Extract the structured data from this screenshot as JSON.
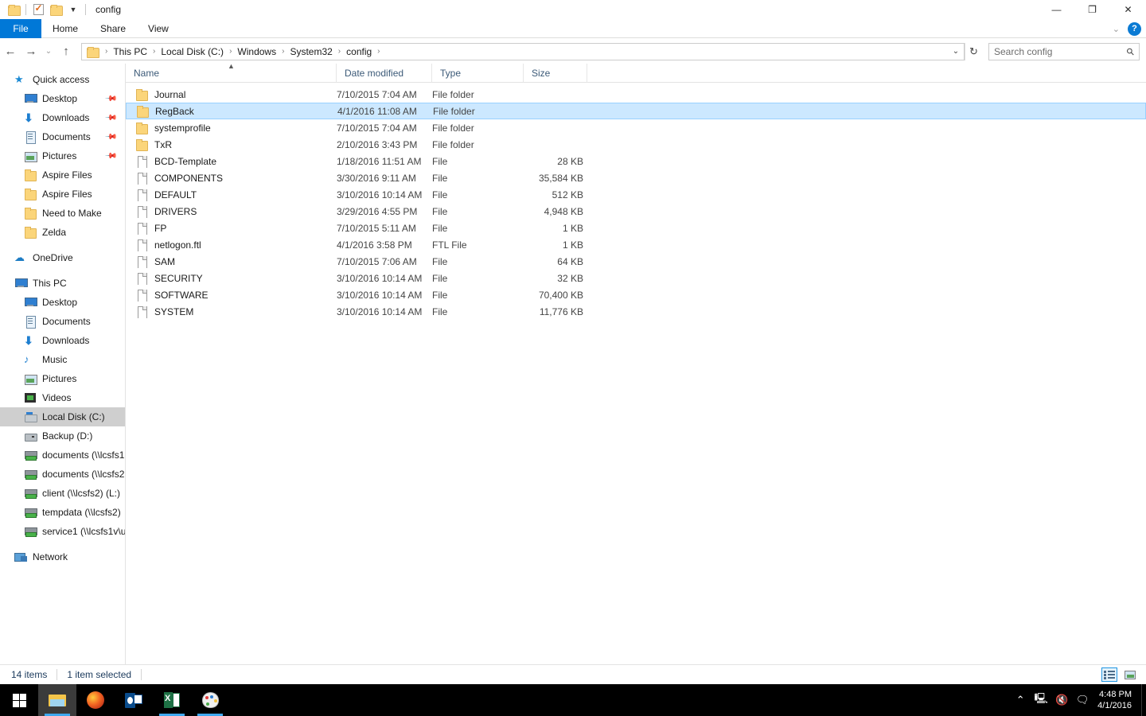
{
  "window": {
    "title": "config",
    "quick_access_toolbar": [
      {
        "name": "folder-icon",
        "label": "Folder"
      },
      {
        "name": "properties-icon",
        "label": "Properties"
      },
      {
        "name": "new-folder-icon",
        "label": "New folder"
      },
      {
        "name": "customize-chevron-icon",
        "label": "▾"
      }
    ],
    "controls": {
      "minimize": "—",
      "restore": "❐",
      "close": "✕"
    }
  },
  "ribbon": {
    "tabs": [
      {
        "label": "File",
        "active": true
      },
      {
        "label": "Home",
        "active": false
      },
      {
        "label": "Share",
        "active": false
      },
      {
        "label": "View",
        "active": false
      }
    ],
    "expand_chevron": "⌄",
    "help_label": "?"
  },
  "addressbar": {
    "back": "←",
    "forward": "→",
    "recent": "⌄",
    "up": "↑",
    "breadcrumbs": [
      "This PC",
      "Local Disk (C:)",
      "Windows",
      "System32",
      "config"
    ],
    "separator": "›",
    "dropdown": "⌄",
    "refresh": "↻"
  },
  "search": {
    "placeholder": "Search config",
    "icon": "search-icon"
  },
  "sidebar": {
    "groups": [
      {
        "name": "Quick access",
        "icon": "star-icon",
        "items": [
          {
            "label": "Desktop",
            "icon": "monitor-icon",
            "pinned": true
          },
          {
            "label": "Downloads",
            "icon": "download-arrow-icon",
            "pinned": true
          },
          {
            "label": "Documents",
            "icon": "document-icon",
            "pinned": true
          },
          {
            "label": "Pictures",
            "icon": "picture-icon",
            "pinned": true
          },
          {
            "label": "Aspire Files",
            "icon": "folder-icon",
            "pinned": false
          },
          {
            "label": "Aspire Files",
            "icon": "folder-icon",
            "pinned": false
          },
          {
            "label": "Need to Make",
            "icon": "folder-icon",
            "pinned": false
          },
          {
            "label": "Zelda",
            "icon": "folder-icon",
            "pinned": false
          }
        ]
      },
      {
        "name": "OneDrive",
        "icon": "cloud-icon",
        "items": []
      },
      {
        "name": "This PC",
        "icon": "computer-icon",
        "items": [
          {
            "label": "Desktop",
            "icon": "monitor-icon",
            "selected": false
          },
          {
            "label": "Documents",
            "icon": "document-icon",
            "selected": false
          },
          {
            "label": "Downloads",
            "icon": "download-arrow-icon",
            "selected": false
          },
          {
            "label": "Music",
            "icon": "music-note-icon",
            "selected": false
          },
          {
            "label": "Pictures",
            "icon": "picture-icon",
            "selected": false
          },
          {
            "label": "Videos",
            "icon": "video-icon",
            "selected": false
          },
          {
            "label": "Local Disk (C:)",
            "icon": "hard-disk-icon",
            "selected": true
          },
          {
            "label": "Backup (D:)",
            "icon": "disk-drive-icon",
            "selected": false
          },
          {
            "label": "documents (\\\\lcsfs1",
            "icon": "network-drive-icon",
            "selected": false
          },
          {
            "label": "documents (\\\\lcsfs2",
            "icon": "network-drive-icon",
            "selected": false
          },
          {
            "label": "client (\\\\lcsfs2) (L:)",
            "icon": "network-drive-icon",
            "selected": false
          },
          {
            "label": "tempdata (\\\\lcsfs2)",
            "icon": "network-drive-icon",
            "selected": false
          },
          {
            "label": "service1 (\\\\lcsfs1v\\u",
            "icon": "network-drive-icon",
            "selected": false
          }
        ]
      },
      {
        "name": "Network",
        "icon": "network-icon",
        "items": []
      }
    ]
  },
  "filelist": {
    "columns": [
      {
        "label": "Name",
        "sorted": "asc"
      },
      {
        "label": "Date modified",
        "sorted": null
      },
      {
        "label": "Type",
        "sorted": null
      },
      {
        "label": "Size",
        "sorted": null
      }
    ],
    "sort_arrow": "▲",
    "rows": [
      {
        "name": "Journal",
        "date": "7/10/2015 7:04 AM",
        "type": "File folder",
        "size": "",
        "icon": "folder-icon",
        "selected": false
      },
      {
        "name": "RegBack",
        "date": "4/1/2016 11:08 AM",
        "type": "File folder",
        "size": "",
        "icon": "folder-icon",
        "selected": true
      },
      {
        "name": "systemprofile",
        "date": "7/10/2015 7:04 AM",
        "type": "File folder",
        "size": "",
        "icon": "folder-icon",
        "selected": false
      },
      {
        "name": "TxR",
        "date": "2/10/2016 3:43 PM",
        "type": "File folder",
        "size": "",
        "icon": "folder-icon",
        "selected": false
      },
      {
        "name": "BCD-Template",
        "date": "1/18/2016 11:51 AM",
        "type": "File",
        "size": "28 KB",
        "icon": "file-icon",
        "selected": false
      },
      {
        "name": "COMPONENTS",
        "date": "3/30/2016 9:11 AM",
        "type": "File",
        "size": "35,584 KB",
        "icon": "file-icon",
        "selected": false
      },
      {
        "name": "DEFAULT",
        "date": "3/10/2016 10:14 AM",
        "type": "File",
        "size": "512 KB",
        "icon": "file-icon",
        "selected": false
      },
      {
        "name": "DRIVERS",
        "date": "3/29/2016 4:55 PM",
        "type": "File",
        "size": "4,948 KB",
        "icon": "file-icon",
        "selected": false
      },
      {
        "name": "FP",
        "date": "7/10/2015 5:11 AM",
        "type": "File",
        "size": "1 KB",
        "icon": "file-icon",
        "selected": false
      },
      {
        "name": "netlogon.ftl",
        "date": "4/1/2016 3:58 PM",
        "type": "FTL File",
        "size": "1 KB",
        "icon": "file-icon",
        "selected": false
      },
      {
        "name": "SAM",
        "date": "7/10/2015 7:06 AM",
        "type": "File",
        "size": "64 KB",
        "icon": "file-icon",
        "selected": false
      },
      {
        "name": "SECURITY",
        "date": "3/10/2016 10:14 AM",
        "type": "File",
        "size": "32 KB",
        "icon": "file-icon",
        "selected": false
      },
      {
        "name": "SOFTWARE",
        "date": "3/10/2016 10:14 AM",
        "type": "File",
        "size": "70,400 KB",
        "icon": "file-icon",
        "selected": false
      },
      {
        "name": "SYSTEM",
        "date": "3/10/2016 10:14 AM",
        "type": "File",
        "size": "11,776 KB",
        "icon": "file-icon",
        "selected": false
      }
    ]
  },
  "statusbar": {
    "item_count": "14 items",
    "selection": "1 item selected",
    "views": [
      {
        "name": "details-view-button",
        "active": true
      },
      {
        "name": "large-icons-view-button",
        "active": false
      }
    ]
  },
  "taskbar": {
    "start": "start-button",
    "apps": [
      {
        "name": "file-explorer-taskbar-button",
        "active": true
      },
      {
        "name": "firefox-taskbar-button",
        "active": false
      },
      {
        "name": "outlook-taskbar-button",
        "active": false
      },
      {
        "name": "excel-taskbar-button",
        "active": false
      },
      {
        "name": "paint-taskbar-button",
        "active": false
      }
    ],
    "tray": {
      "chevron": "⌃",
      "network": "network-tray-icon",
      "volume": "volume-muted-tray-icon",
      "action_center": "action-center-icon",
      "time": "4:48 PM",
      "date": "4/1/2016"
    }
  },
  "colors": {
    "accent": "#0078d7",
    "selection": "#cce8ff",
    "selection_border": "#99d1ff",
    "sidebar_selected": "#cfcfcf",
    "column_header_text": "#3c5a78"
  }
}
